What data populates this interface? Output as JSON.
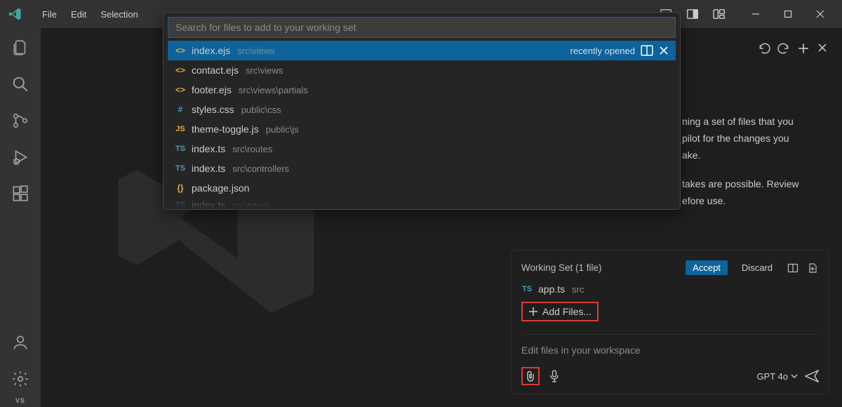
{
  "menu": {
    "file": "File",
    "edit": "Edit",
    "selection": "Selection"
  },
  "quickopen": {
    "placeholder": "Search for files to add to your working set",
    "recently_opened": "recently opened",
    "items": [
      {
        "icon": "ejs",
        "name": "index.ejs",
        "path": "src\\views"
      },
      {
        "icon": "ejs",
        "name": "contact.ejs",
        "path": "src\\views"
      },
      {
        "icon": "ejs",
        "name": "footer.ejs",
        "path": "src\\views\\partials"
      },
      {
        "icon": "css",
        "name": "styles.css",
        "path": "public\\css"
      },
      {
        "icon": "js",
        "name": "theme-toggle.js",
        "path": "public\\js"
      },
      {
        "icon": "ts",
        "name": "index.ts",
        "path": "src\\routes"
      },
      {
        "icon": "ts",
        "name": "index.ts",
        "path": "src\\controllers"
      },
      {
        "icon": "json",
        "name": "package.json",
        "path": ""
      },
      {
        "icon": "ts",
        "name": "index.ts",
        "path": "src\\types"
      }
    ]
  },
  "copilot_header": {
    "undo": "↶",
    "redo": "↷",
    "new": "+",
    "close": "×"
  },
  "copilot_text": {
    "l1": "ning a set of files that you",
    "l2": "pilot for the changes you",
    "l3": "ake.",
    "l4": "takes are possible. Review",
    "l5": "efore use."
  },
  "working_set": {
    "title": "Working Set (1 file)",
    "accept": "Accept",
    "discard": "Discard",
    "file": {
      "icon": "ts",
      "name": "app.ts",
      "path": "src"
    },
    "add_files": "Add Files...",
    "input_placeholder": "Edit files in your workspace",
    "model": "GPT 4o"
  }
}
